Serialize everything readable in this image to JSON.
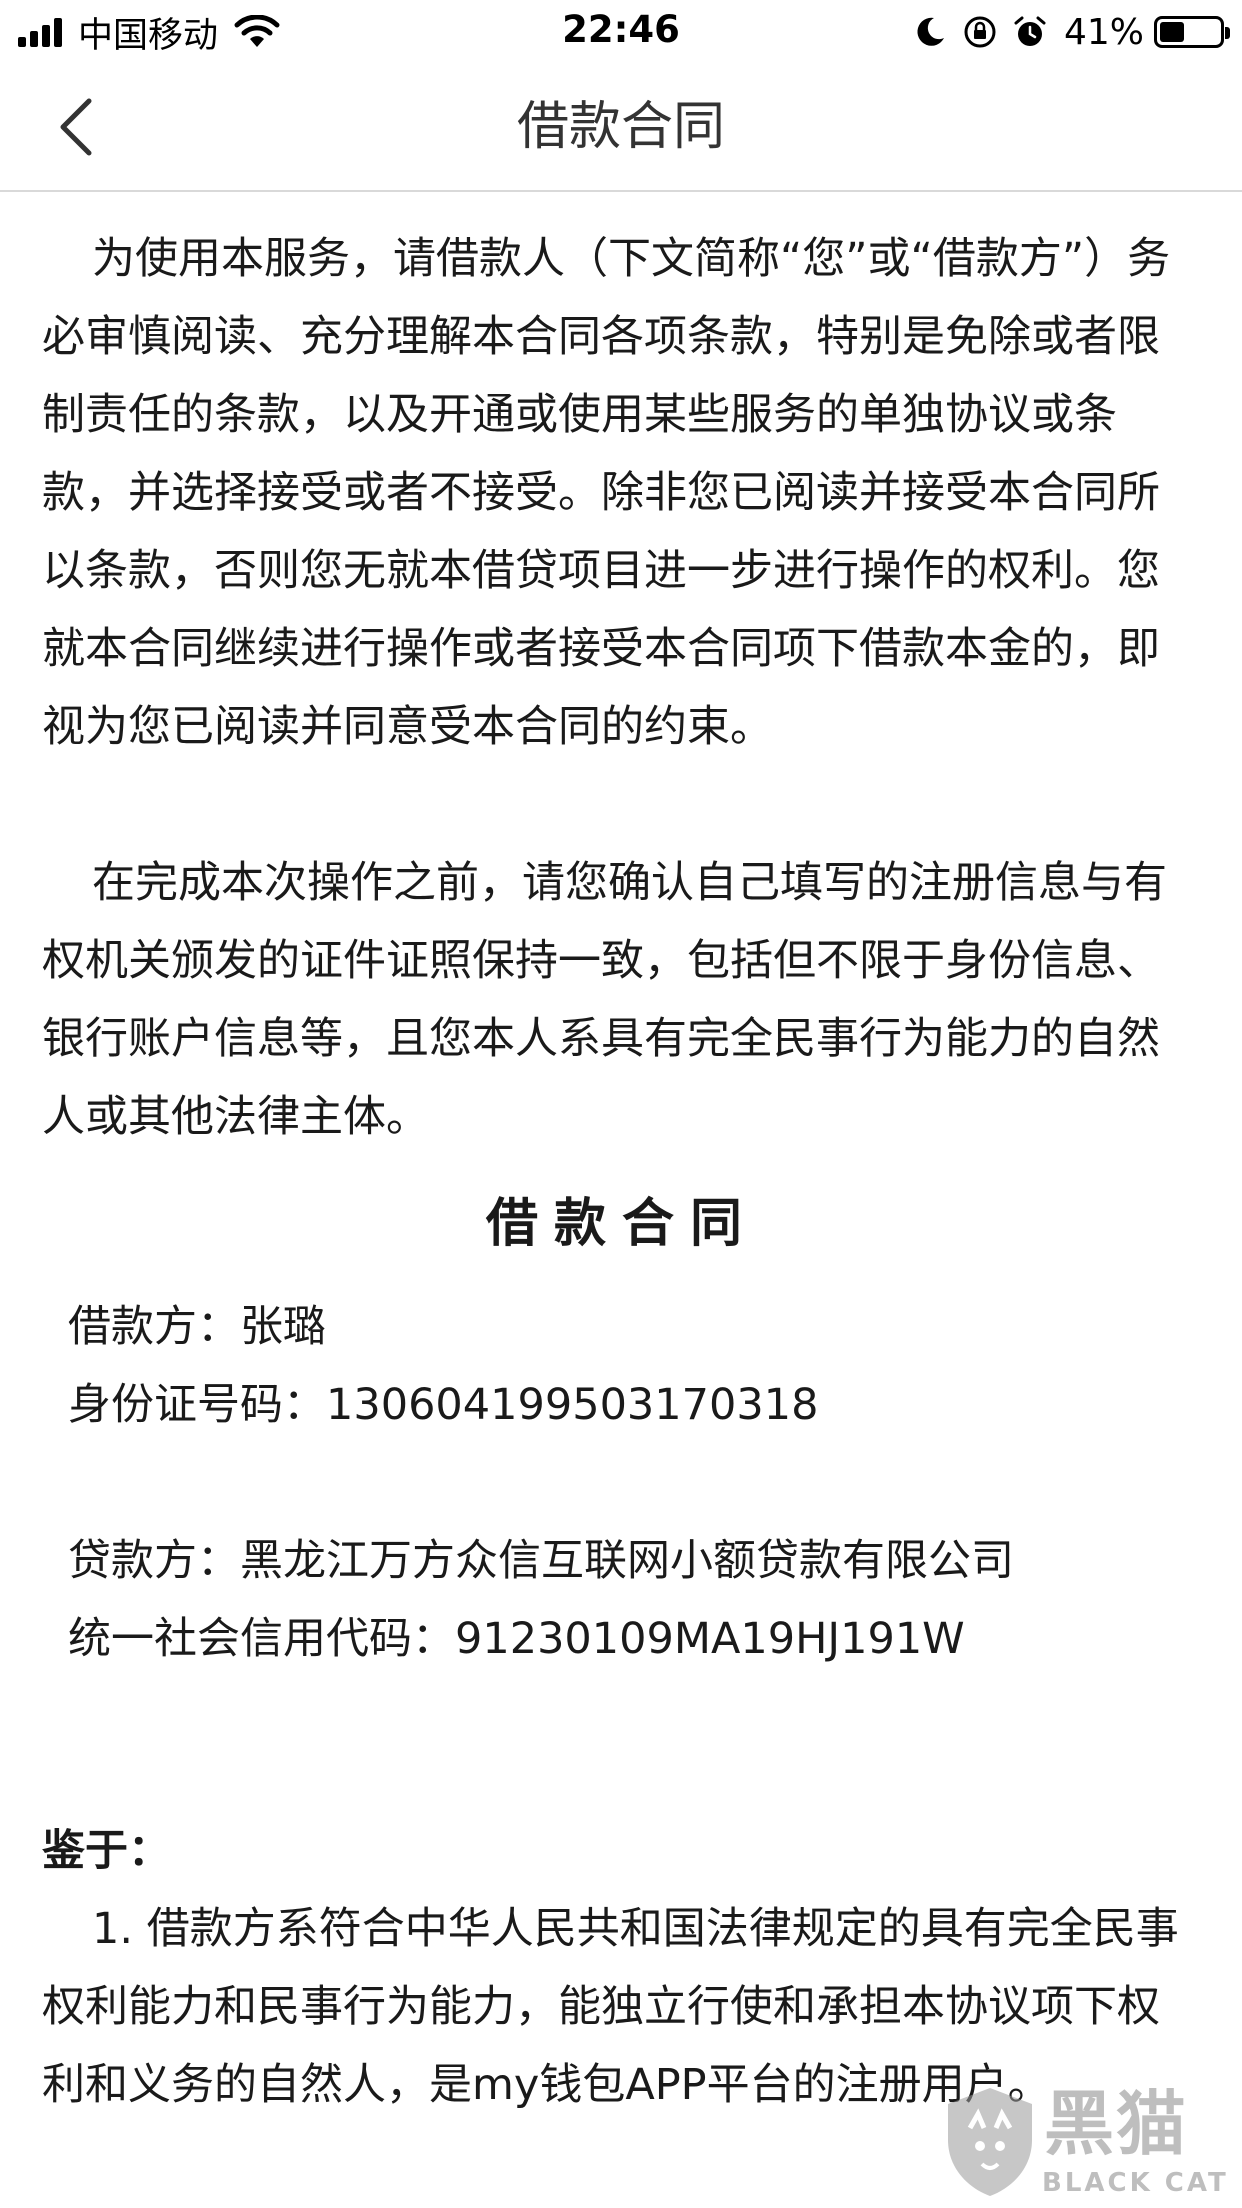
{
  "status_bar": {
    "carrier": "中国移动",
    "time": "22:46",
    "battery_percent": "41%",
    "battery_level": 0.41,
    "icons": [
      "signal-icon",
      "wifi-icon",
      "moon-icon",
      "orientation-lock-icon",
      "alarm-icon",
      "battery-icon"
    ]
  },
  "nav": {
    "title": "借款合同",
    "back_icon": "chevron-left-icon"
  },
  "intro_paragraphs": [
    "为使用本服务，请借款人（下文简称“您”或“借款方”）务必审慎阅读、充分理解本合同各项条款，特别是免除或者限制责任的条款，以及开通或使用某些服务的单独协议或条款，并选择接受或者不接受。除非您已阅读并接受本合同所以条款，否则您无就本借贷项目进一步进行操作的权利。您就本合同继续进行操作或者接受本合同项下借款本金的，即视为您已阅读并同意受本合同的约束。",
    "在完成本次操作之前，请您确认自己填写的注册信息与有权机关颁发的证件证照保持一致，包括但不限于身份信息、银行账户信息等，且您本人系具有完全民事行为能力的自然人或其他法律主体。"
  ],
  "contract": {
    "heading": "借款合同",
    "borrower_label": "借款方：",
    "borrower_name": "张璐",
    "id_label": "身份证号码：",
    "id_number": "130604199503170318",
    "lender_label": "贷款方：",
    "lender_name": "黑龙江万方众信互联网小额贷款有限公司",
    "credit_code_label": "统一社会信用代码：",
    "credit_code": "91230109MA19HJ191W",
    "whereas": "鉴于：",
    "clauses": [
      "1. 借款方系符合中华人民共和国法律规定的具有完全民事权利能力和民事行为能力，能独立行使和承担本协议项下权利和义务的自然人，是my钱包APP平台的注册用户。"
    ]
  },
  "watermark": {
    "text": "黑猫",
    "sub": "BLACK CAT"
  },
  "colors": {
    "text": "#1a1a1a",
    "divider": "#d9d9d9",
    "watermark": "#8a8a8a"
  }
}
